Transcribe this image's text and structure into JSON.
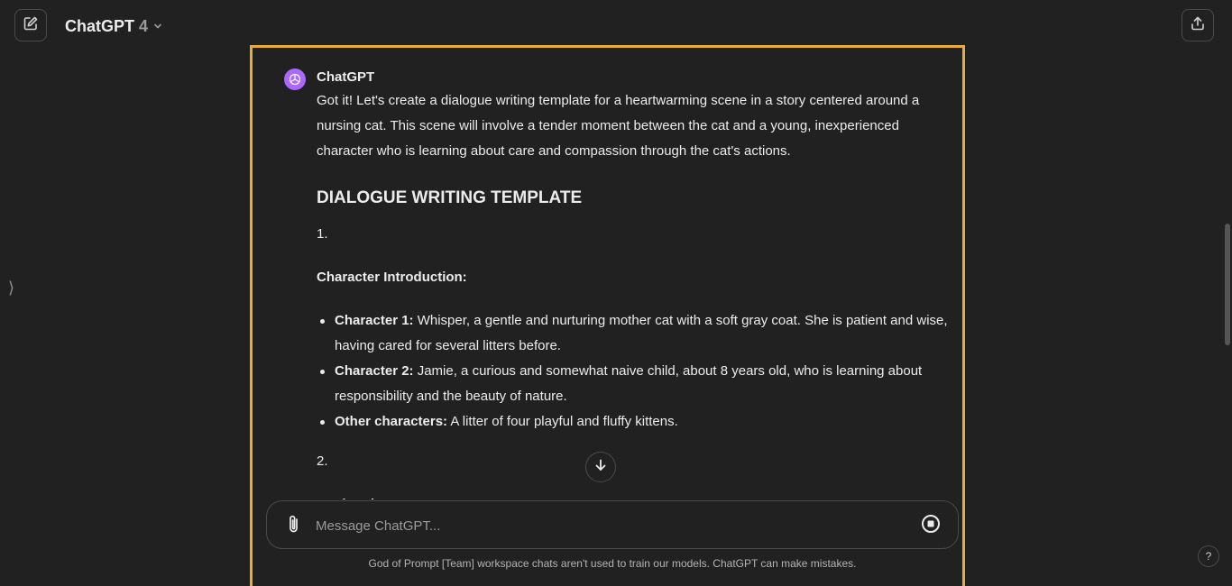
{
  "header": {
    "model_name": "ChatGPT",
    "model_version": "4"
  },
  "message": {
    "sender": "ChatGPT",
    "intro": "Got it! Let's create a dialogue writing template for a heartwarming scene in a story centered around a nursing cat. This scene will involve a tender moment between the cat and a young, inexperienced character who is learning about care and compassion through the cat's actions.",
    "heading": "DIALOGUE WRITING TEMPLATE",
    "sections": [
      {
        "number": "1.",
        "title": "Character Introduction:",
        "items": [
          {
            "label": "Character 1:",
            "text": " Whisper, a gentle and nurturing mother cat with a soft gray coat. She is patient and wise, having cared for several litters before."
          },
          {
            "label": "Character 2:",
            "text": " Jamie, a curious and somewhat naive child, about 8 years old, who is learning about responsibility and the beauty of nature."
          },
          {
            "label": "Other characters:",
            "text": " A litter of four playful and fluffy kittens."
          }
        ]
      },
      {
        "number": "2.",
        "title": "Setting the Scene:"
      }
    ]
  },
  "composer": {
    "placeholder": "Message ChatGPT..."
  },
  "footer": {
    "note": "God of Prompt [Team] workspace chats aren't used to train our models. ChatGPT can make mistakes.",
    "help_label": "?"
  },
  "colors": {
    "background": "#212121",
    "highlight_frame": "#e7ad3c",
    "avatar": "#ab68ff"
  }
}
